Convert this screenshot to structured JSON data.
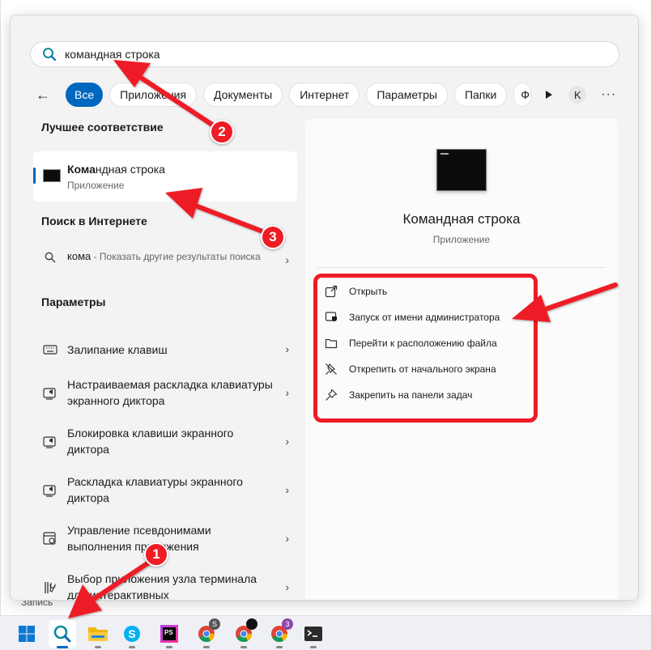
{
  "search": {
    "query": "командная строка"
  },
  "filters": {
    "back_label": "←",
    "chips": [
      "Все",
      "Приложения",
      "Документы",
      "Интернет",
      "Параметры",
      "Папки",
      "Ф"
    ],
    "avatar": "K",
    "more": "···"
  },
  "best_match": {
    "section": "Лучшее соответствие",
    "title_bold": "Кома",
    "title_rest": "ндная строка",
    "subtitle": "Приложение"
  },
  "web": {
    "section": "Поиск в Интернете",
    "query": "кома",
    "hint": " - Показать другие результаты поиска"
  },
  "settings": {
    "section": "Параметры",
    "items": [
      {
        "label": "Залипание клавиш",
        "icon": "keyboard-icon"
      },
      {
        "label": "Настраиваемая раскладка клавиатуры экранного диктора",
        "icon": "narrator-icon"
      },
      {
        "label": "Блокировка клавиши экранного диктора",
        "icon": "narrator-icon"
      },
      {
        "label": "Раскладка клавиатуры экранного диктора",
        "icon": "narrator-icon"
      },
      {
        "label": "Управление псевдонимами выполнения приложения",
        "icon": "app-settings-icon"
      },
      {
        "label": "Выбор приложения узла терминала для интерактивных",
        "icon": "tools-icon"
      }
    ]
  },
  "detail": {
    "title": "Командная строка",
    "subtitle": "Приложение",
    "actions": [
      {
        "label": "Открыть",
        "icon": "open-external-icon"
      },
      {
        "label": "Запуск от имени администратора",
        "icon": "shield-icon"
      },
      {
        "label": "Перейти к расположению файла",
        "icon": "folder-icon"
      },
      {
        "label": "Открепить от начального экрана",
        "icon": "unpin-icon"
      },
      {
        "label": "Закрепить на панели задач",
        "icon": "pin-icon"
      }
    ]
  },
  "background": {
    "label": "Запись"
  },
  "chevron": "›",
  "annotations": {
    "badge1": "1",
    "badge2": "2",
    "badge3": "3"
  },
  "taskbar": {
    "items": [
      "windows-start",
      "search",
      "file-explorer",
      "skype",
      "phpstorm",
      "chrome-profile-s",
      "chrome-profile-dark",
      "chrome-profile-3",
      "terminal"
    ],
    "badges": {
      "chrome_s": "S",
      "chrome_3": "3"
    }
  },
  "colors": {
    "accent": "#0067c0",
    "annotation_red": "#ee1c25"
  }
}
